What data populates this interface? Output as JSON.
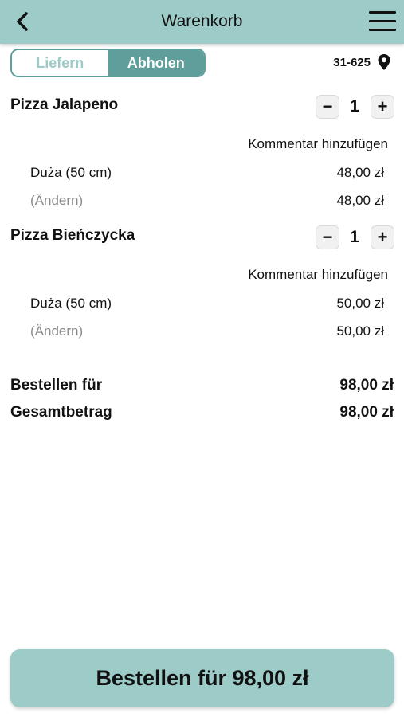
{
  "header": {
    "title": "Warenkorb",
    "back_icon": "chevron-left-icon",
    "menu_icon": "hamburger-menu-icon"
  },
  "delivery_toggle": {
    "options": [
      "Liefern",
      "Abholen"
    ],
    "selected": "Abholen"
  },
  "location": {
    "postal_code": "31-625",
    "icon": "map-pin-icon"
  },
  "cart": {
    "items": [
      {
        "name": "Pizza Jalapeno",
        "quantity": "1",
        "comment_label": "Kommentar hinzufügen",
        "variant": "Duża (50 cm)",
        "variant_price": "48,00 zł",
        "change_label": "(Ändern)",
        "item_total": "48,00 zł"
      },
      {
        "name": "Pizza Bieńczycka",
        "quantity": "1",
        "comment_label": "Kommentar hinzufügen",
        "variant": "Duża (50 cm)",
        "variant_price": "50,00 zł",
        "change_label": "(Ändern)",
        "item_total": "50,00 zł"
      }
    ],
    "stepper": {
      "minus": "−",
      "plus": "+"
    }
  },
  "summary": {
    "order_for_label": "Bestellen für",
    "order_for_value": "98,00 zł",
    "total_label": "Gesamtbetrag",
    "total_value": "98,00 zł"
  },
  "footer": {
    "order_button_label": "Bestellen für 98,00 zł"
  },
  "colors": {
    "header_bg": "#9ccbc8",
    "accent": "#5e9f9b",
    "button_bg": "#9ccbc8"
  }
}
